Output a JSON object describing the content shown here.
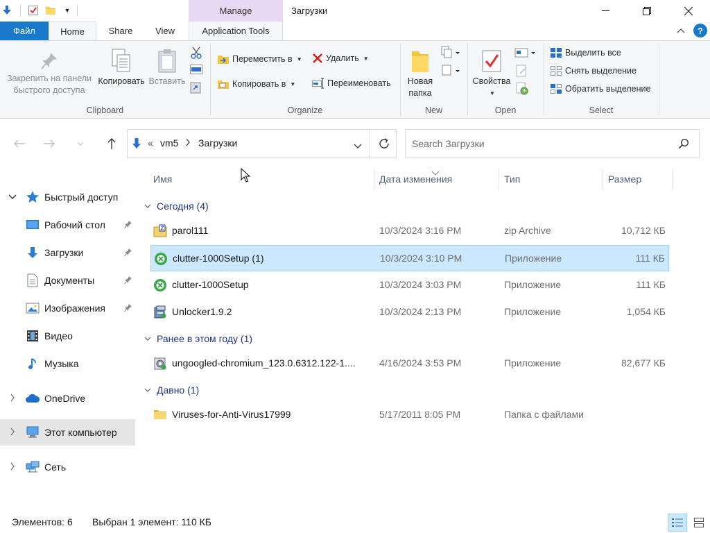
{
  "quick_access_toolbar": {
    "icons": [
      "down-arrow-icon",
      "properties-check-icon",
      "new-folder-icon",
      "customize-dropdown-icon"
    ]
  },
  "title": {
    "contextual_tab_group": "Manage",
    "window_title": "Загрузки"
  },
  "ribbon_tabs": {
    "file": "Файл",
    "home": "Home",
    "share": "Share",
    "view": "View",
    "app_tools": "Application Tools"
  },
  "ribbon": {
    "clipboard": {
      "label": "Clipboard",
      "pin_label_1": "Закрепить на панели",
      "pin_label_2": "быстрого доступа",
      "copy": "Копировать",
      "paste": "Вставить"
    },
    "organize": {
      "label": "Organize",
      "move_to": "Переместить в",
      "copy_to": "Копировать в",
      "delete": "Удалить",
      "rename": "Переименовать"
    },
    "new": {
      "label": "New",
      "new_folder_1": "Новая",
      "new_folder_2": "папка"
    },
    "open": {
      "label": "Open",
      "properties": "Свойства"
    },
    "select": {
      "label": "Select",
      "select_all": "Выделить все",
      "select_none": "Снять выделение",
      "invert": "Обратить выделение"
    }
  },
  "address": {
    "overflow": "«",
    "crumbs": [
      "vm5",
      "Загрузки"
    ]
  },
  "search": {
    "placeholder": "Search Загрузки"
  },
  "nav_pane": {
    "quick_access": "Быстрый доступ",
    "desktop": "Рабочий стол",
    "downloads": "Загрузки",
    "documents": "Документы",
    "pictures": "Изображения",
    "video": "Видео",
    "music": "Музыка",
    "onedrive": "OneDrive",
    "this_pc": "Этот компьютер",
    "network": "Сеть"
  },
  "columns": {
    "name": "Имя",
    "date": "Дата изменения",
    "type": "Тип",
    "size": "Размер"
  },
  "groups": {
    "today": "Сегодня (4)",
    "earlier_this_year": "Ранее в этом году (1)",
    "long_ago": "Давно (1)"
  },
  "files": [
    {
      "name": "parol111",
      "date": "10/3/2024 3:16 PM",
      "type": "zip Archive",
      "size": "10,712 КБ",
      "icon": "zip-archive-icon",
      "selected": false
    },
    {
      "name": "clutter-1000Setup (1)",
      "date": "10/3/2024 3:10 PM",
      "type": "Приложение",
      "size": "111 КБ",
      "icon": "setup-app-icon",
      "selected": true
    },
    {
      "name": "clutter-1000Setup",
      "date": "10/3/2024 3:03 PM",
      "type": "Приложение",
      "size": "111 КБ",
      "icon": "setup-app-icon",
      "selected": false
    },
    {
      "name": "Unlocker1.9.2",
      "date": "10/3/2024 2:13 PM",
      "type": "Приложение",
      "size": "1,054 КБ",
      "icon": "installer-app-icon",
      "selected": false
    },
    {
      "name": "ungoogled-chromium_123.0.6312.122-1....",
      "date": "4/16/2024 3:53 PM",
      "type": "Приложение",
      "size": "82,677 КБ",
      "icon": "installer-gear-icon",
      "selected": false
    },
    {
      "name": "Viruses-for-Anti-Virus17999",
      "date": "5/17/2011 8:05 PM",
      "type": "Папка с файлами",
      "size": "",
      "icon": "folder-icon",
      "selected": false
    }
  ],
  "status": {
    "items": "Элементов: 6",
    "selection": "Выбран 1 элемент: 110 КБ"
  },
  "colors": {
    "file_tab": "#1979ca",
    "selection_fill": "#cce8ff",
    "selection_border": "#99d1ff",
    "manage_band": "#e9d8f4",
    "group_header": "#1e3287"
  }
}
